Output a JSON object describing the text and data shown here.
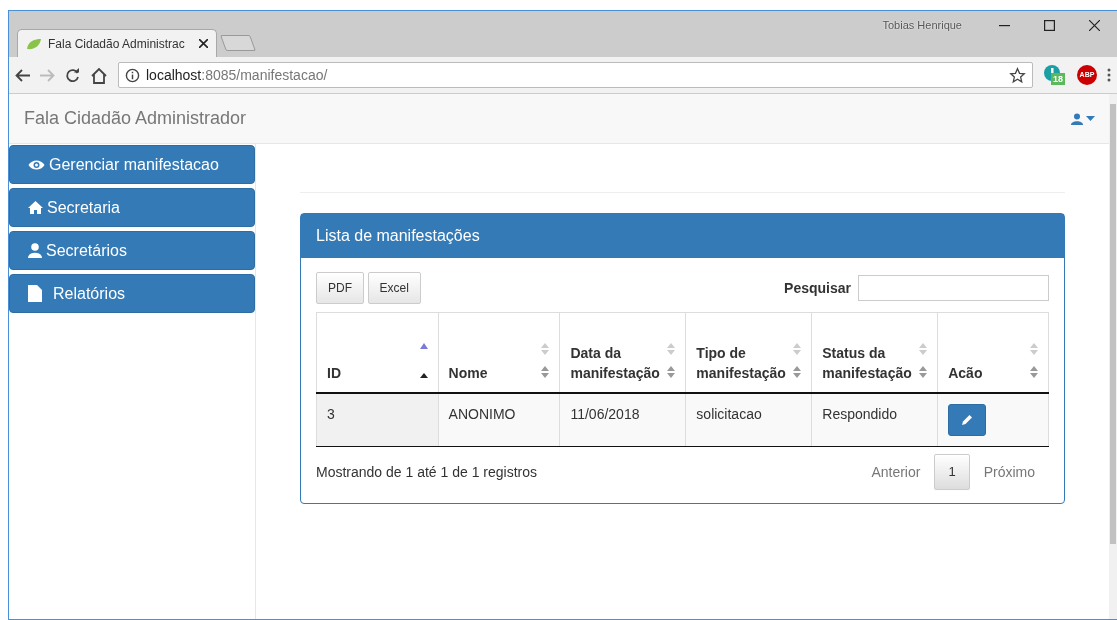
{
  "browser": {
    "tab_title": "Fala Cidadão Administrac",
    "profile": "Tobias Henrique",
    "address_host": "localhost",
    "address_path": ":8085/manifestacao/",
    "extension_badge": "18",
    "adblock": "ABP"
  },
  "navbar": {
    "brand": "Fala Cidadão Administrador"
  },
  "sidebar": {
    "items": [
      {
        "label": "Gerenciar manifestacao"
      },
      {
        "label": "Secretaria"
      },
      {
        "label": "Secretários"
      },
      {
        "label": "Relatórios"
      }
    ]
  },
  "panel": {
    "title": "Lista de manifestações",
    "buttons": [
      "PDF",
      "Excel"
    ],
    "search_label": "Pesquisar",
    "table": {
      "columns": [
        {
          "label": "ID",
          "sorted": true
        },
        {
          "label": "Nome",
          "sorted": false
        },
        {
          "label": "Data da manifestação",
          "sorted": false
        },
        {
          "label": "Tipo de manifestação",
          "sorted": false
        },
        {
          "label": "Status da manifestação",
          "sorted": false
        },
        {
          "label": "Acão",
          "sorted": false
        }
      ],
      "rows": [
        {
          "cells": [
            "3",
            "ANONIMO",
            "11/06/2018",
            "solicitacao",
            "Respondido"
          ]
        }
      ]
    },
    "info": "Mostrando de 1 até 1 de 1 registros",
    "pagination": {
      "previous": "Anterior",
      "pages": [
        {
          "label": "1",
          "selected": true
        }
      ],
      "next": "Próximo"
    }
  }
}
